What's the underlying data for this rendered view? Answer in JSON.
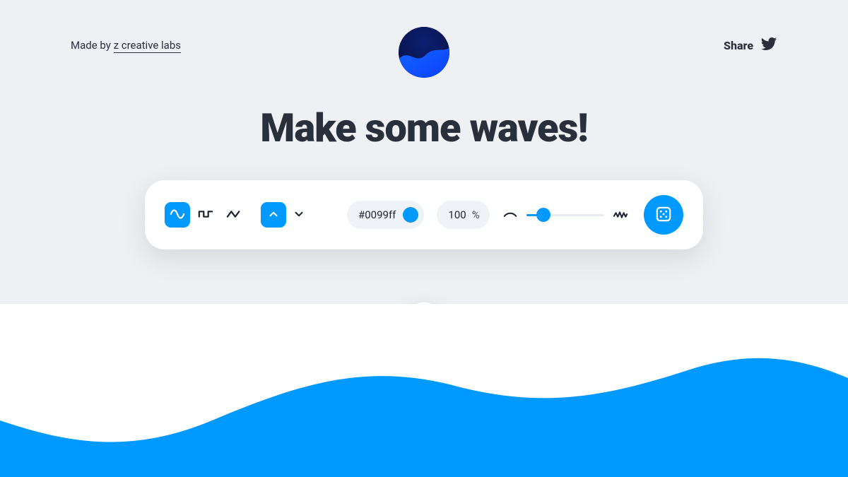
{
  "header": {
    "credit_prefix": "Made by ",
    "credit_link": "z creative labs",
    "share_label": "Share"
  },
  "title": "Make some waves!",
  "controls": {
    "color_hex": "#0099ff",
    "opacity_value": "100",
    "opacity_unit": "%"
  },
  "colors": {
    "accent": "#0099ff"
  }
}
